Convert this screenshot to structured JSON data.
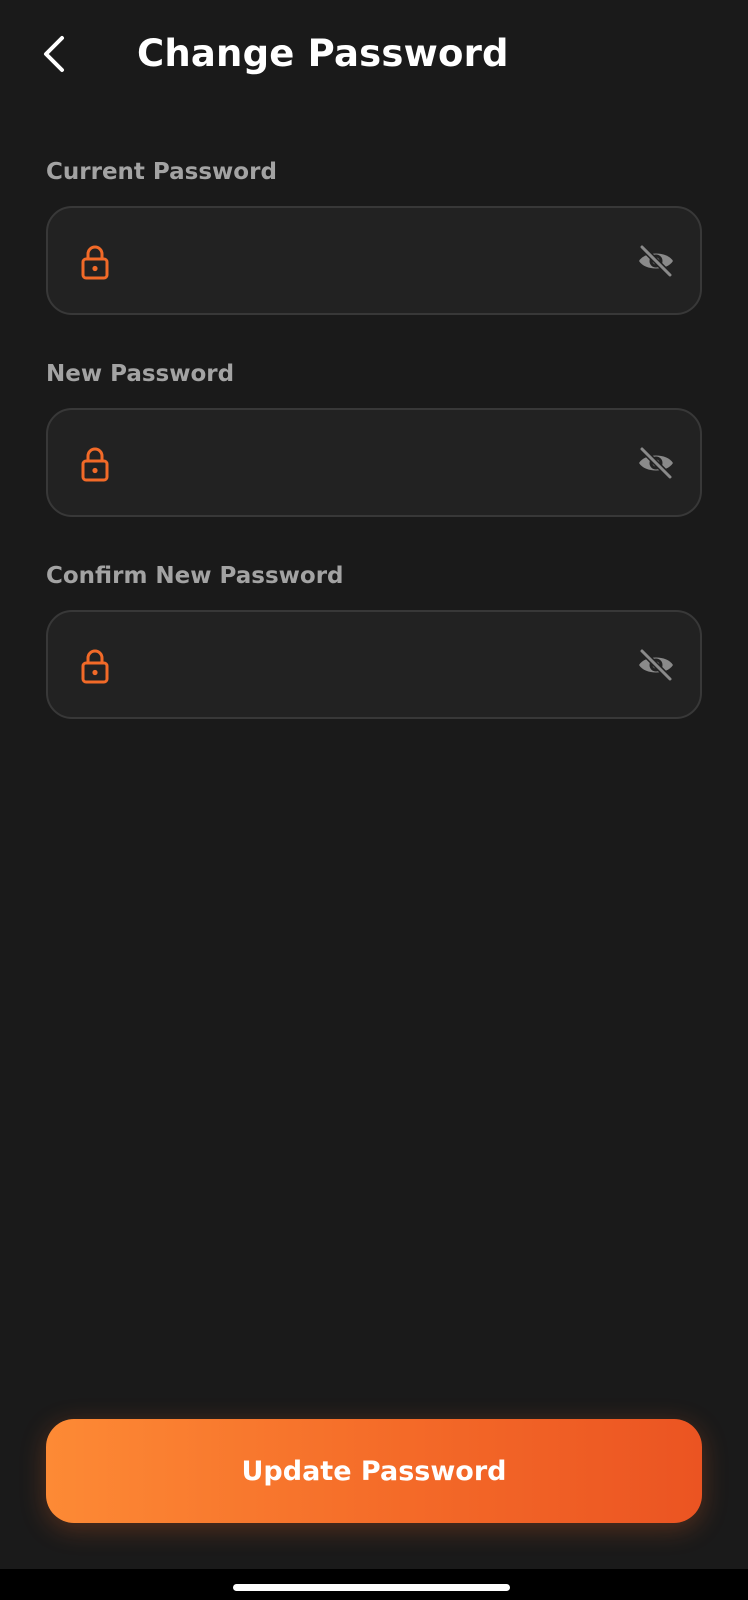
{
  "header": {
    "title": "Change Password",
    "back_icon": "chevron-left-icon"
  },
  "fields": [
    {
      "label": "Current Password",
      "value": "",
      "placeholder": "",
      "lock_icon": "lock-icon",
      "toggle_icon": "eye-off-icon"
    },
    {
      "label": "New Password",
      "value": "",
      "placeholder": "",
      "lock_icon": "lock-icon",
      "toggle_icon": "eye-off-icon"
    },
    {
      "label": "Confirm New Password",
      "value": "",
      "placeholder": "",
      "lock_icon": "lock-icon",
      "toggle_icon": "eye-off-icon"
    }
  ],
  "actions": {
    "update_label": "Update Password"
  },
  "colors": {
    "background": "#1a1a1a",
    "field_background": "#222222",
    "field_border": "#383838",
    "label": "#a3a3a3",
    "accent": "#f26a28",
    "accent_start": "#fd8a35",
    "accent_end": "#eb5422",
    "icon_gray": "#8a8a8a"
  }
}
